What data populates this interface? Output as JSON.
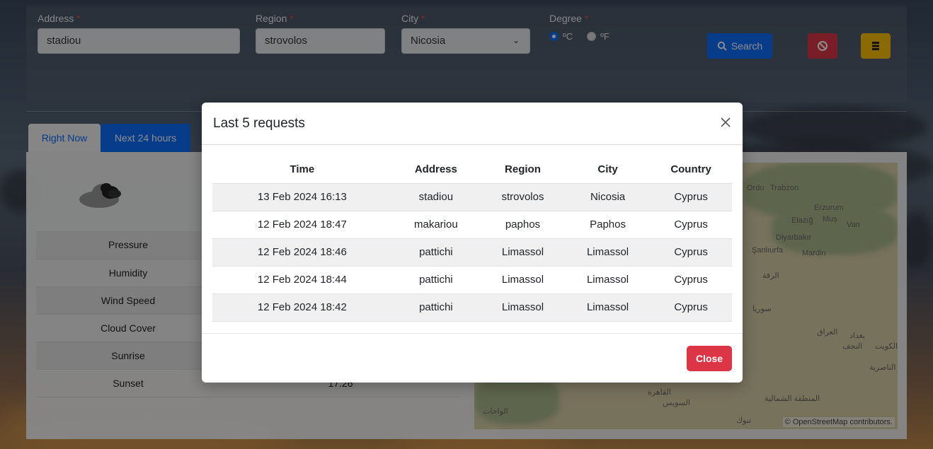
{
  "form": {
    "address_label": "Address",
    "region_label": "Region",
    "city_label": "City",
    "degree_label": "Degree",
    "required_mark": "*",
    "address_value": "stadiou",
    "region_value": "strovolos",
    "city_value": "Nicosia",
    "degree_options": [
      "ºC",
      "ºF"
    ],
    "degree_selected": "ºC",
    "search_label": "Search"
  },
  "tabs": [
    {
      "label": "Right Now",
      "active": true
    },
    {
      "label": "Next 24 hours",
      "active": false
    }
  ],
  "weather": {
    "rows": [
      {
        "label": "Pressure",
        "value": ""
      },
      {
        "label": "Humidity",
        "value": ""
      },
      {
        "label": "Wind Speed",
        "value": ""
      },
      {
        "label": "Cloud Cover",
        "value": ""
      },
      {
        "label": "Sunrise",
        "value": ""
      },
      {
        "label": "Sunset",
        "value": "17:26"
      }
    ]
  },
  "map": {
    "labels": [
      "Ordu",
      "Trabzon",
      "Erzurum",
      "Elazığ",
      "Muş",
      "Van",
      "Diyarbakır",
      "Şanlıurfa",
      "Mardin",
      "Erzurum",
      "الرقة",
      "سوريا",
      "العراق",
      "بغداد",
      "النجف",
      "الكويت",
      "الناصرية",
      "تبوك",
      "القاهرة",
      "السويس",
      "الواحات",
      "المنطقة الشمالية"
    ],
    "attribution": "© OpenStreetMap contributors."
  },
  "modal": {
    "title": "Last 5 requests",
    "columns": [
      "Time",
      "Address",
      "Region",
      "City",
      "Country"
    ],
    "rows": [
      [
        "13 Feb 2024 16:13",
        "stadiou",
        "strovolos",
        "Nicosia",
        "Cyprus"
      ],
      [
        "12 Feb 2024 18:47",
        "makariou",
        "paphos",
        "Paphos",
        "Cyprus"
      ],
      [
        "12 Feb 2024 18:46",
        "pattichi",
        "Limassol",
        "Limassol",
        "Cyprus"
      ],
      [
        "12 Feb 2024 18:44",
        "pattichi",
        "Limassol",
        "Limassol",
        "Cyprus"
      ],
      [
        "12 Feb 2024 18:42",
        "pattichi",
        "Limassol",
        "Limassol",
        "Cyprus"
      ]
    ],
    "close_label": "Close"
  },
  "colors": {
    "primary": "#0d6efd",
    "danger": "#dc3545",
    "warning": "#ffc107"
  }
}
